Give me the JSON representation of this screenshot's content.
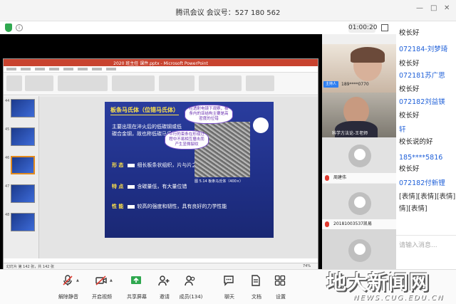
{
  "app": {
    "title": "腾讯会议 会议号：527 180 562",
    "timer": "01:00:20",
    "window_controls": [
      "—",
      "□",
      "✕"
    ]
  },
  "ppt": {
    "window_title": "2020 班主任 课件.pptx - Microsoft PowerPoint",
    "slide_numbers": [
      "44",
      "45",
      "46",
      "47",
      "48"
    ],
    "status_left": "幻灯片 第 142 张，共 142 张",
    "status_zoom": "74%"
  },
  "slide": {
    "heading": "板条马氏体（位错马氏体）",
    "paragraph": "主要出现在淬火后的低碳钢或低碳合金钢，故也称低碳马氏体",
    "shape_key": "形 态",
    "shape_text": "细长板条状组织，片与片之间互相平行",
    "feature_key": "特 点",
    "feature_text": "含碳量低，有大量位错",
    "property_key": "性 能",
    "property_text": "较高的强度和韧性，具有良好的力学性能",
    "cloud1": "在透射电镜下观察，板条内的亚结构主要是高密度的位错",
    "cloud2": "平行的束条在形成过程中不易相互撞击而产生显微裂纹",
    "caption": "图 5.14 板条马氏体（400×）"
  },
  "participants": [
    {
      "name": "189****0770",
      "host_label": "主持人"
    },
    {
      "name": "科学方法论-王老师"
    },
    {
      "name": "周建伟"
    },
    {
      "name": "20181003537凯易"
    }
  ],
  "chat": [
    {
      "type": "text",
      "value": "校长好"
    },
    {
      "type": "user",
      "value": "072184-刘梦琦"
    },
    {
      "type": "text",
      "value": "校长好"
    },
    {
      "type": "user",
      "value": "072181苏广思"
    },
    {
      "type": "text",
      "value": "校长好"
    },
    {
      "type": "user",
      "value": "072182刘益镁"
    },
    {
      "type": "text",
      "value": "校长好"
    },
    {
      "type": "user",
      "value": "轩"
    },
    {
      "type": "text",
      "value": "校长说的好"
    },
    {
      "type": "user",
      "value": "185****5816"
    },
    {
      "type": "text",
      "value": "校长好"
    },
    {
      "type": "user",
      "value": "072182付新锂"
    },
    {
      "type": "text",
      "value": "[表情][表情][表情][表"
    },
    {
      "type": "text",
      "value": "情][表情]"
    }
  ],
  "chat_input_placeholder": "请输入消息...",
  "toolbar": {
    "unmute": "解除静音",
    "video": "开启视频",
    "share": "共享屏幕",
    "invite": "邀请",
    "members": "成员(134)",
    "chat": "聊天",
    "docs": "文档",
    "settings": "设置"
  },
  "watermark": {
    "text": "地大新闻网",
    "url": "NEWS.CUG.EDU.CN"
  },
  "colors": {
    "link_blue": "#1e5fd8",
    "ppt_red": "#c8432f",
    "slide_blue": "#2a3d9e",
    "host_blue": "#2f7ff0"
  }
}
